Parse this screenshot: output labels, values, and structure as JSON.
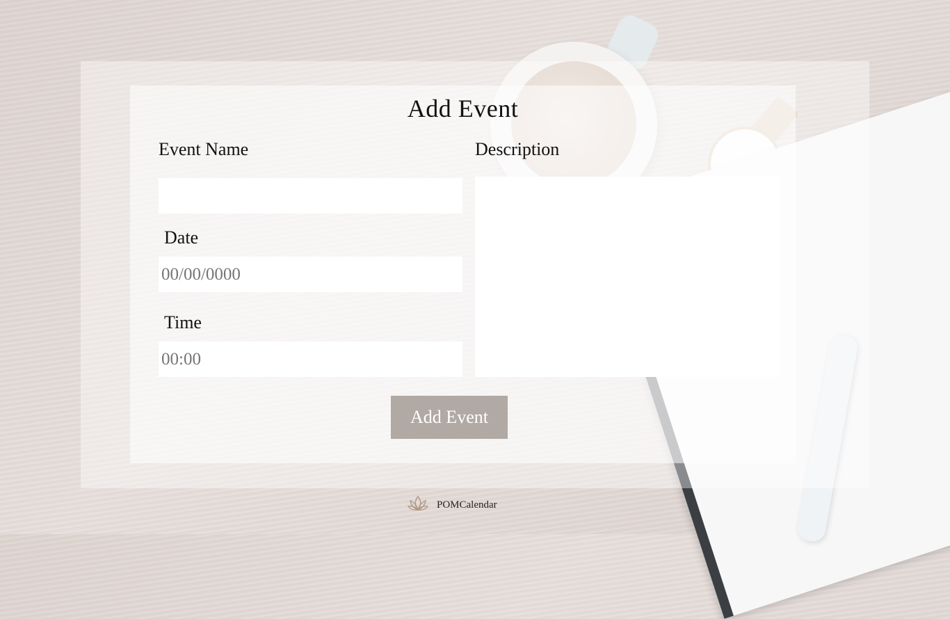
{
  "form": {
    "title": "Add Event",
    "event_name_label": "Event Name",
    "event_name_value": "",
    "description_label": "Description",
    "description_value": "",
    "date_label": "Date",
    "date_placeholder": "00/00/0000",
    "time_label": "Time",
    "time_placeholder": "00:00",
    "submit_label": "Add Event"
  },
  "footer": {
    "brand": "POMCalendar",
    "logo_icon": "lotus-icon"
  },
  "colors": {
    "button_bg": "#b1a9a3",
    "logo": "#b19a86"
  }
}
